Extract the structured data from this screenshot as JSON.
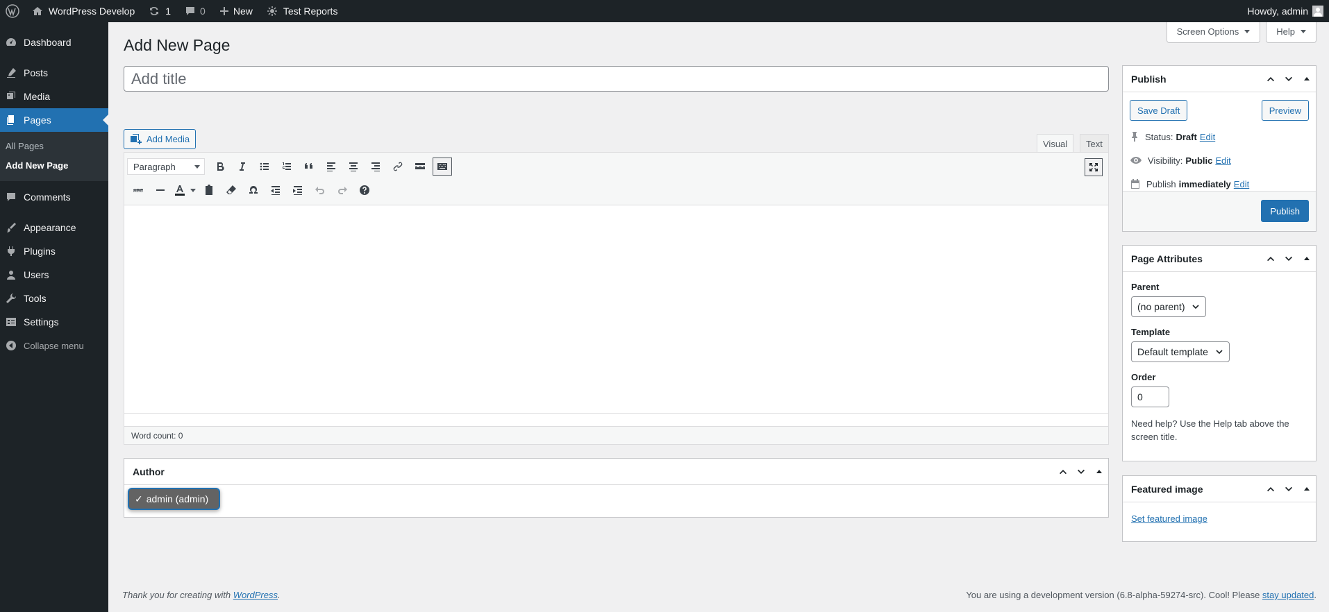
{
  "adminbar": {
    "site_name": "WordPress Develop",
    "updates_count": "1",
    "comments_count": "0",
    "new_label": "New",
    "test_reports_label": "Test Reports",
    "howdy": "Howdy, admin"
  },
  "menu": {
    "dashboard": "Dashboard",
    "posts": "Posts",
    "media": "Media",
    "pages": "Pages",
    "all_pages": "All Pages",
    "add_new_page": "Add New Page",
    "comments": "Comments",
    "appearance": "Appearance",
    "plugins": "Plugins",
    "users": "Users",
    "tools": "Tools",
    "settings": "Settings",
    "collapse": "Collapse menu"
  },
  "screen_meta": {
    "screen_options": "Screen Options",
    "help": "Help"
  },
  "page": {
    "title": "Add New Page",
    "title_placeholder": "Add title",
    "add_media": "Add Media",
    "tab_visual": "Visual",
    "tab_text": "Text",
    "format_select": "Paragraph",
    "word_count": "Word count: 0"
  },
  "author_box": {
    "title": "Author",
    "selected": "admin (admin)",
    "check": "✓"
  },
  "publish_box": {
    "title": "Publish",
    "save_draft": "Save Draft",
    "preview": "Preview",
    "status_label": "Status:",
    "status_value": "Draft",
    "visibility_label": "Visibility:",
    "visibility_value": "Public",
    "publish_label": "Publish",
    "publish_value": "immediately",
    "edit": "Edit",
    "publish_button": "Publish"
  },
  "page_attributes": {
    "title": "Page Attributes",
    "parent_label": "Parent",
    "parent_value": "(no parent)",
    "template_label": "Template",
    "template_value": "Default template",
    "order_label": "Order",
    "order_value": "0",
    "help_text": "Need help? Use the Help tab above the screen title."
  },
  "featured_image": {
    "title": "Featured image",
    "link": "Set featured image"
  },
  "footer": {
    "thanks_prefix": "Thank you for creating with ",
    "thanks_link": "WordPress",
    "thanks_suffix": ".",
    "version_text": "You are using a development version (6.8-alpha-59274-src). Cool! Please ",
    "version_link": "stay updated",
    "version_suffix": "."
  },
  "colors": {
    "accent": "#2271b1",
    "adminbar": "#1d2327",
    "background": "#f0f0f1"
  }
}
